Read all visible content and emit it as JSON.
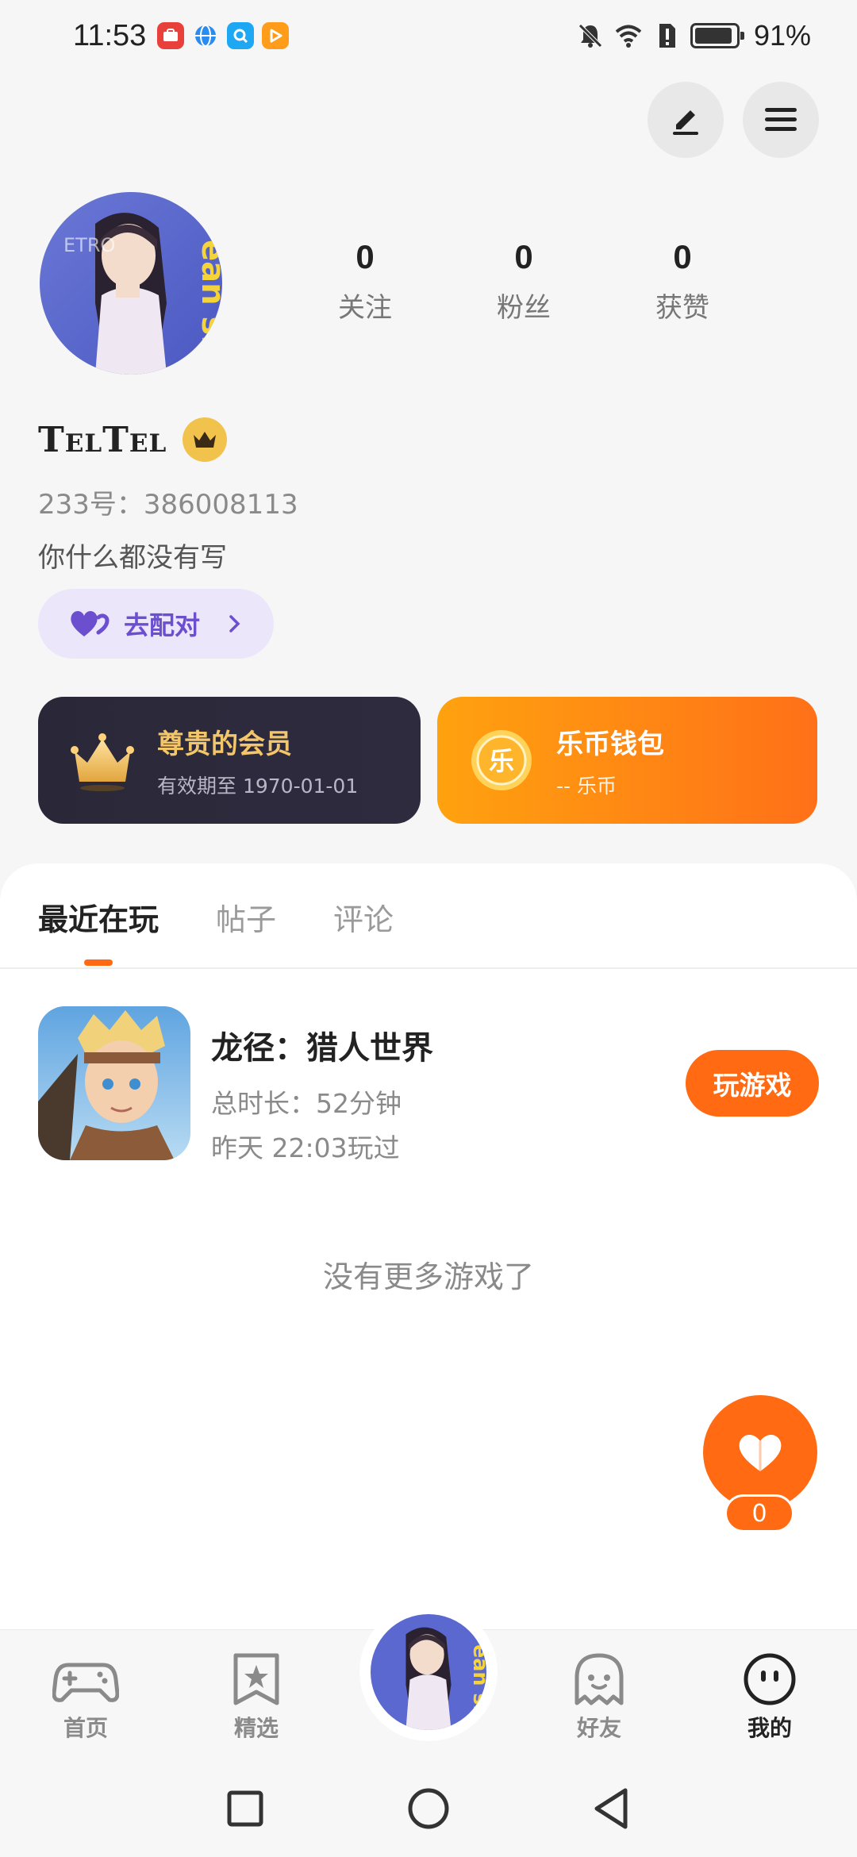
{
  "status_bar": {
    "time": "11:53",
    "battery": "91%",
    "apps": [
      {
        "name": "huawei-app-icon",
        "color": "#e8403a"
      },
      {
        "name": "browser-icon",
        "color": "#2a8cf0"
      },
      {
        "name": "search-app-icon",
        "color": "#1ea7f2"
      },
      {
        "name": "video-app-icon",
        "color": "#ff9d1a"
      }
    ]
  },
  "profile": {
    "stats": [
      {
        "value": "0",
        "label": "关注"
      },
      {
        "value": "0",
        "label": "粉丝"
      },
      {
        "value": "0",
        "label": "获赞"
      }
    ],
    "username": "TelTel",
    "user_id": "233号：386008113",
    "bio": "你什么都没有写",
    "match_label": "去配对"
  },
  "cards": {
    "member": {
      "title": "尊贵的会员",
      "subtitle": "有效期至 1970-01-01"
    },
    "wallet": {
      "title": "乐币钱包",
      "subtitle": "-- 乐币",
      "coin_glyph": "乐"
    }
  },
  "tabs": [
    {
      "label": "最近在玩",
      "active": true
    },
    {
      "label": "帖子",
      "active": false
    },
    {
      "label": "评论",
      "active": false
    }
  ],
  "recent_game": {
    "title": "龙径：猎人世界",
    "duration": "总时长：52分钟",
    "last_played": "昨天 22:03玩过",
    "play_label": "玩游戏"
  },
  "no_more_text": "没有更多游戏了",
  "like_count": "0",
  "bottom_nav": [
    {
      "label": "首页",
      "icon": "gamepad-icon",
      "active": false
    },
    {
      "label": "精选",
      "icon": "star-bookmark-icon",
      "active": false
    },
    {
      "label": "好友",
      "icon": "ghost-icon",
      "active": false
    },
    {
      "label": "我的",
      "icon": "smiley-face-icon",
      "active": true
    }
  ],
  "colors": {
    "accent": "#ff6a13",
    "member_gold": "#f3c66a",
    "match_purple": "#6b4fcf"
  }
}
